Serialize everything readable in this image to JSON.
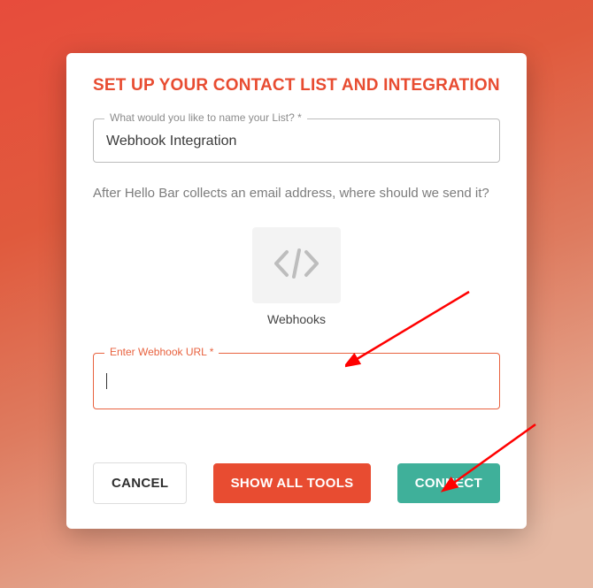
{
  "header": {
    "title": "SET UP YOUR CONTACT LIST AND INTEGRATION"
  },
  "list_name": {
    "label": "What would you like to name your List? *",
    "value": "Webhook Integration"
  },
  "subtext": "After Hello Bar collects an email address, where should we send it?",
  "tool": {
    "label": "Webhooks"
  },
  "url_field": {
    "label": "Enter Webhook URL *",
    "value": ""
  },
  "buttons": {
    "cancel": "CANCEL",
    "show_all": "SHOW ALL TOOLS",
    "connect": "CONNECT"
  }
}
